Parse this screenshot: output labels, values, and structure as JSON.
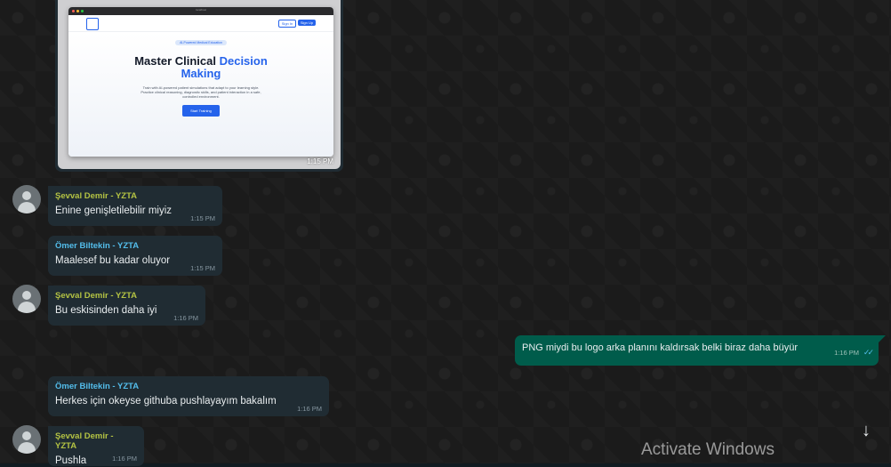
{
  "image_message": {
    "time": "1:15 PM",
    "preview": {
      "url": "localhost",
      "nav_signin": "Sign In",
      "nav_signup": "Sign Up",
      "badge": "AI-Powered Medical Education",
      "title_part1": "Master Clinical ",
      "title_highlight": "Decision",
      "title_part2": "Making",
      "subtitle": "Train with AI-powered patient simulations that adapt to your learning style. Practice clinical reasoning, diagnostic skills, and patient interaction in a safe, controlled environment.",
      "cta": "Start Training"
    }
  },
  "messages": [
    {
      "sender": "Şevval Demir - YZTA",
      "text": "Enine genişletilebilir miyiz",
      "time": "1:15 PM"
    },
    {
      "sender": "Ömer Biltekin - YZTA",
      "text": "Maalesef bu kadar oluyor",
      "time": "1:15 PM"
    },
    {
      "sender": "Şevval Demir - YZTA",
      "text": "Bu eskisinden daha iyi",
      "time": "1:16 PM"
    },
    {
      "text": "PNG miydi bu logo arka planını kaldırsak belki biraz daha büyür",
      "time": "1:16 PM",
      "ticks": "✓✓"
    },
    {
      "sender": "Ömer Biltekin - YZTA",
      "text": "Herkes için okeyse githuba pushlayayım bakalım",
      "time": "1:16 PM"
    },
    {
      "sender": "Şevval Demir - YZTA",
      "text": "Pushla",
      "time": "1:16 PM"
    }
  ],
  "scroll_down_icon": "↓",
  "watermark": "Activate Windows",
  "colors": {
    "incoming_bubble": "#202c33",
    "outgoing_bubble": "#005c4b",
    "sevval_name": "#b4c343",
    "omer_name": "#53bdeb"
  }
}
